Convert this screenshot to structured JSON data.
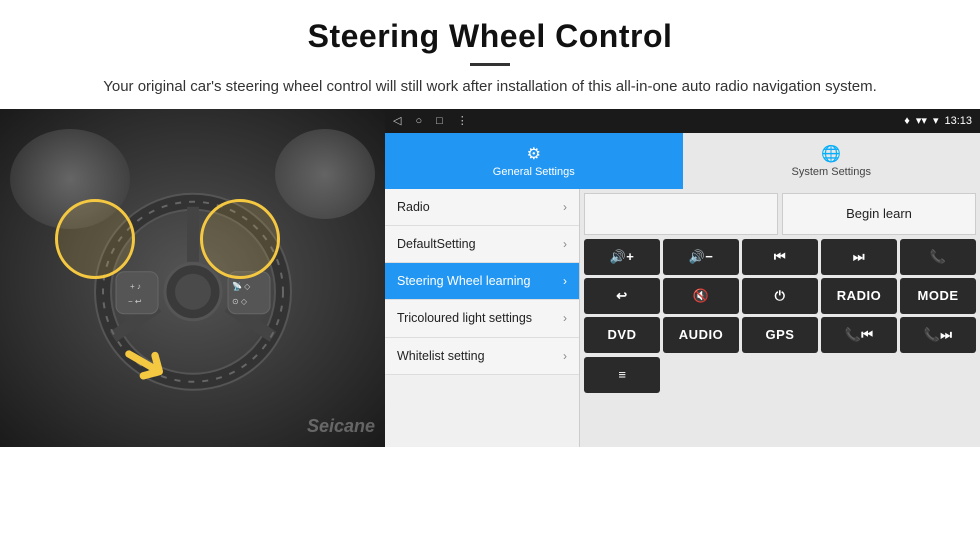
{
  "header": {
    "title": "Steering Wheel Control",
    "subtitle": "Your original car's steering wheel control will still work after installation of this all-in-one auto radio navigation system."
  },
  "statusbar": {
    "nav_back": "◁",
    "nav_home": "○",
    "nav_square": "□",
    "nav_menu": "⋮",
    "signal": "▾▾",
    "wifi": "▾",
    "time": "13:13",
    "location": "♦"
  },
  "tabs": [
    {
      "id": "general",
      "label": "General Settings",
      "icon": "⚙",
      "active": true
    },
    {
      "id": "system",
      "label": "System Settings",
      "icon": "🌐",
      "active": false
    }
  ],
  "menu_items": [
    {
      "label": "Radio",
      "active": false
    },
    {
      "label": "DefaultSetting",
      "active": false
    },
    {
      "label": "Steering Wheel learning",
      "active": true
    },
    {
      "label": "Tricoloured light settings",
      "active": false
    },
    {
      "label": "Whitelist setting",
      "active": false
    }
  ],
  "begin_learn_button": "Begin learn",
  "control_buttons": [
    {
      "label": "🔊+",
      "row": 1,
      "col": 1
    },
    {
      "label": "🔊−",
      "row": 1,
      "col": 2
    },
    {
      "label": "⏮",
      "row": 1,
      "col": 3
    },
    {
      "label": "⏭",
      "row": 1,
      "col": 4
    },
    {
      "label": "📞",
      "row": 1,
      "col": 5
    },
    {
      "label": "↩",
      "row": 2,
      "col": 1
    },
    {
      "label": "🔇",
      "row": 2,
      "col": 2
    },
    {
      "label": "⏻",
      "row": 2,
      "col": 3
    },
    {
      "label": "RADIO",
      "row": 2,
      "col": 4
    },
    {
      "label": "MODE",
      "row": 2,
      "col": 5
    },
    {
      "label": "DVD",
      "row": 3,
      "col": 1
    },
    {
      "label": "AUDIO",
      "row": 3,
      "col": 2
    },
    {
      "label": "GPS",
      "row": 3,
      "col": 3
    },
    {
      "label": "📞⏮",
      "row": 3,
      "col": 4
    },
    {
      "label": "⏭📞",
      "row": 3,
      "col": 5
    }
  ],
  "bottom_button": {
    "label": "≡"
  },
  "watermark": "Seicane"
}
